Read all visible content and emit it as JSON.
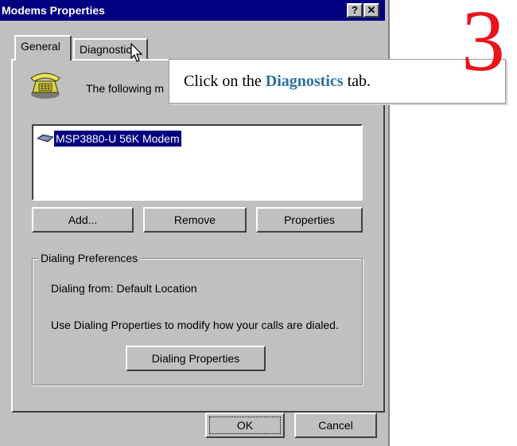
{
  "window": {
    "title": "Modems Properties",
    "help_button": "?",
    "close_button": "✕"
  },
  "tabs": [
    {
      "label": "General",
      "active": true
    },
    {
      "label": "Diagnostics",
      "active": false
    }
  ],
  "general": {
    "intro_text": "The following m",
    "modems": [
      "MSP3880-U 56K Modem"
    ],
    "buttons": {
      "add": "Add...",
      "remove": "Remove",
      "properties": "Properties"
    },
    "dialing_preferences": {
      "group_label": "Dialing Preferences",
      "dialing_from": "Dialing from:   Default Location",
      "description": "Use Dialing Properties to modify how your calls are dialed.",
      "dialing_properties_button": "Dialing Properties"
    }
  },
  "footer": {
    "ok": "OK",
    "cancel": "Cancel"
  },
  "callout": {
    "prefix": "Click on the ",
    "keyword": "Diagnostics",
    "suffix": " tab."
  },
  "step_number": "3",
  "colors": {
    "titlebar": "#000080",
    "face": "#c0c0c0",
    "selection": "#000080",
    "callout_keyword": "#2a6fa3",
    "step_number": "#e8141c"
  },
  "icons": [
    "phone-icon",
    "modem-icon",
    "mouse-cursor-icon"
  ]
}
